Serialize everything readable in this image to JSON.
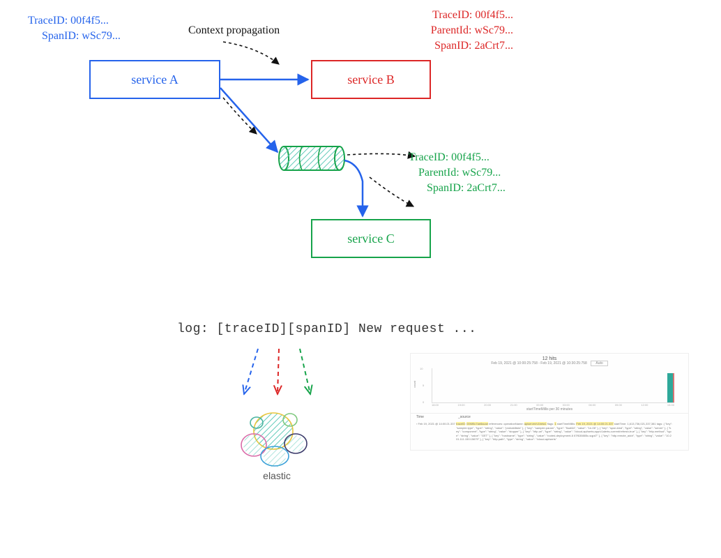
{
  "serviceA": {
    "label": "service A",
    "traceId": "TraceID: 00f4f5...",
    "spanId": "SpanID: wSc79..."
  },
  "serviceB": {
    "label": "service B",
    "traceId": "TraceID: 00f4f5...",
    "parentId": "ParentId: wSc79...",
    "spanId": "SpanID: 2aCrt7..."
  },
  "serviceC": {
    "label": "service C",
    "traceId": "TraceID: 00f4f5...",
    "parentId": "ParentId: wSc79...",
    "spanId": "SpanID: 2aCrt7..."
  },
  "propagationLabel": "Context propagation",
  "log": {
    "text": "log: [traceID][spanID] New request ..."
  },
  "elastic": {
    "caption": "elastic"
  },
  "kibana": {
    "hits": "12 hits",
    "range": "Feb 19, 2021 @ 10:00:25:758 - Feb 19, 2021 @ 10:30:25:758",
    "bucket": "Auto",
    "axisLabel": "startTimeMillis per 30 minutes",
    "colTime": "Time",
    "colSource": "_source",
    "ticks": [
      "18:00",
      "19:00",
      "20:00",
      "21:00",
      "00:00",
      "03:00",
      "06:00",
      "09:00",
      "12:00",
      "15:00"
    ],
    "rowTime": "Feb 19, 2021 @ 14:00:21.337",
    "rowText": "traceID: 00f4f5c7ae8acae references: operationName: apiserver/v1beta1 flags: 1 startTimeMillis: Feb 19, 2021 @ 14:00:21.337 startTime: 1,613,736,021,337,381 tags: { \"key\": \"sampler.type\", \"type\": \"string\", \"value\": \"probabilistic\" }, { \"key\": \"sampler.param\", \"type\": \"float64\", \"value\": \"1e-06\" }, { \"key\": \"span.kind\", \"type\": \"string\", \"value\": \"server\" }, { \"key\": \"component\", \"type\": \"string\", \"value\": \"stopper\" }, { \"key\": \"http.url\", \"type\": \"string\", \"value\": \"/cloud-api/serts.app/v1alerts-current/refresh-true\" }, { \"key\": \"http.method\", \"type\": \"string\", \"value\": \"GET\" }, { \"key\": \"hostname\", \"type\": \"string\", \"value\": \"rooted-deployment-6 67f630885c-sqpd7\" }, { \"key\": \"http.remote_addr\", \"type\": \"string\", \"value\": \"10.201.111.150:15679\" }, { \"key\": \"http.path\", \"type\": \"string\", \"value\": \"/cloud-api/serts\""
  },
  "colors": {
    "blue": "#2563eb",
    "red": "#dc2626",
    "green": "#16a34a",
    "teal": "#5ec9b8"
  }
}
